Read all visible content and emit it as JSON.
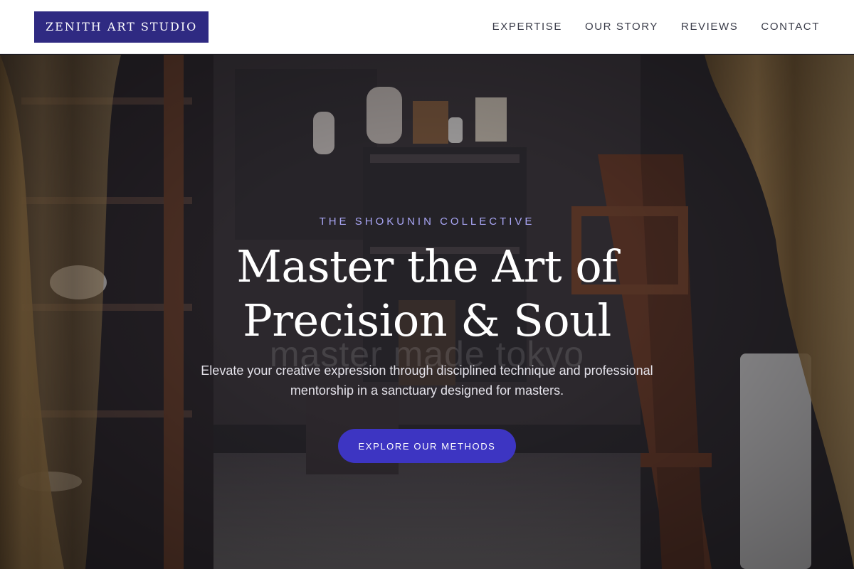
{
  "brand": {
    "name": "ZENITH ART STUDIO"
  },
  "nav": {
    "items": [
      {
        "label": "EXPERTISE"
      },
      {
        "label": "OUR STORY"
      },
      {
        "label": "REVIEWS"
      },
      {
        "label": "CONTACT"
      }
    ]
  },
  "hero": {
    "eyebrow": "THE SHOKUNIN COLLECTIVE",
    "headline_line1": "Master the Art of",
    "headline_line2": "Precision & Soul",
    "subtitle": "Elevate your creative expression through disciplined technique and professional mentorship in a sanctuary designed for masters.",
    "cta_label": "EXPLORE OUR METHODS",
    "background_sign": "master made tokyo"
  },
  "colors": {
    "brand": "#2f2a82",
    "accent": "#3d35c2",
    "eyebrow": "#a9a6f5",
    "header_bg": "#ffffff",
    "nav_text": "#3b3d4a"
  }
}
